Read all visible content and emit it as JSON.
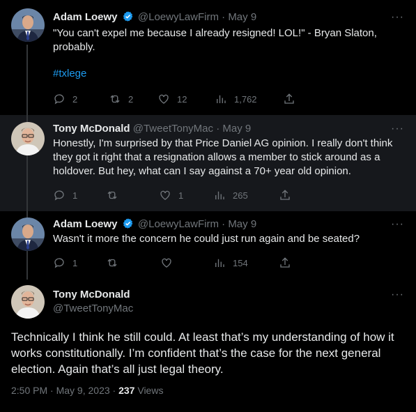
{
  "colors": {
    "background": "#000000",
    "highlight_row": "#16181c",
    "text": "#e7e9ea",
    "secondary": "#71767b",
    "link": "#1d9bf0",
    "verified": "#1d9bf0"
  },
  "tweets": [
    {
      "name": "Adam Loewy",
      "verified": true,
      "handle": "@LoewyLawFirm",
      "separator": "·",
      "date": "May 9",
      "text": "\"You can't expel me because I already resigned!  LOL!\" - Bryan Slaton, probably.",
      "hashtag": "#txlege",
      "replies": "2",
      "retweets": "2",
      "likes": "12",
      "views": "1,762"
    },
    {
      "name": "Tony McDonald",
      "verified": false,
      "handle": "@TweetTonyMac",
      "separator": "·",
      "date": "May 9",
      "text": "Honestly, I'm surprised by that Price Daniel AG opinion. I really don't think they got it right that a resignation allows a member to stick around as a holdover. But hey, what can I say against a 70+ year old opinion.",
      "replies": "1",
      "retweets": "",
      "likes": "1",
      "views": "265"
    },
    {
      "name": "Adam Loewy",
      "verified": true,
      "handle": "@LoewyLawFirm",
      "separator": "·",
      "date": "May 9",
      "text": "Wasn't it more the concern he could just run again and be seated?",
      "replies": "1",
      "retweets": "",
      "likes": "",
      "views": "154"
    }
  ],
  "main_tweet": {
    "name": "Tony McDonald",
    "handle": "@TweetTonyMac",
    "text": "Technically I think he still could. At least that’s my understanding of how it works constitutionally. I’m confident that’s the case for the next general election. Again that’s all just legal theory.",
    "time": "2:50 PM",
    "separator": "·",
    "date": "May 9, 2023",
    "views_count": "237",
    "views_label": "Views"
  },
  "icons": {
    "more": "more-horizontal-icon",
    "reply": "reply-icon",
    "retweet": "retweet-icon",
    "like": "heart-icon",
    "views": "views-chart-icon",
    "share": "share-icon",
    "verified": "verified-badge-icon"
  }
}
